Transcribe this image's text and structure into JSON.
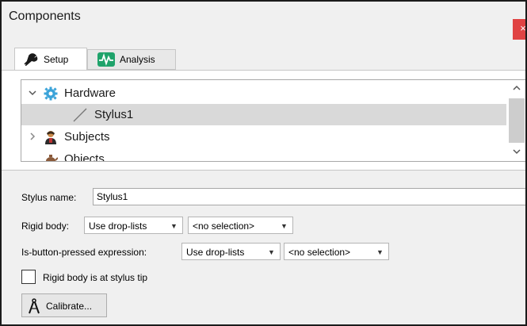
{
  "window": {
    "title": "Components",
    "close_glyph": "×"
  },
  "tabs": [
    {
      "label": "Setup",
      "icon": "wrench-icon",
      "active": true
    },
    {
      "label": "Analysis",
      "icon": "waveform-icon",
      "active": false
    }
  ],
  "tree": {
    "items": [
      {
        "label": "Hardware",
        "icon": "gear-icon",
        "expander": "chevron-down-icon",
        "expanded": true,
        "selected": false
      },
      {
        "label": "Stylus1",
        "icon": "stylus-icon",
        "selected": true
      },
      {
        "label": "Subjects",
        "icon": "person-icon",
        "expander": "chevron-right-icon",
        "expanded": false,
        "selected": false
      },
      {
        "label": "Objects",
        "icon": "teapot-icon",
        "selected": false
      }
    ],
    "scroll_up_glyph": "^",
    "scroll_down_glyph": "v"
  },
  "form": {
    "stylus_name_label": "Stylus name:",
    "stylus_name_value": "Stylus1",
    "rigid_body_label": "Rigid body:",
    "rigid_body_mode": "Use drop-lists",
    "rigid_body_selection": "<no selection>",
    "button_expr_label": "Is-button-pressed expression:",
    "button_expr_mode": "Use drop-lists",
    "button_expr_selection": "<no selection>",
    "tip_checkbox_label": "Rigid body is at stylus tip",
    "tip_checkbox_checked": false,
    "calibrate_label": "Calibrate..."
  },
  "colors": {
    "close_button": "#e04343",
    "analysis_icon": "#1fa36b",
    "hardware_icon": "#3ba3d9",
    "selected_row": "#d9d9d9"
  }
}
